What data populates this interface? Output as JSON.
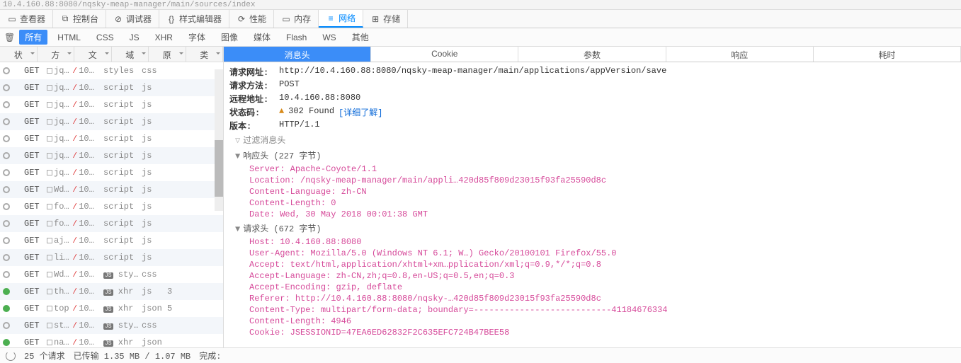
{
  "url_bar": "10.4.160.88:8080/nqsky-meap-manager/main/sources/index",
  "top_tabs": {
    "inspector": "查看器",
    "console": "控制台",
    "debugger": "调试器",
    "style": "样式编辑器",
    "perf": "性能",
    "memory": "内存",
    "network": "网络",
    "storage": "存储"
  },
  "filters": {
    "all": "所有",
    "html": "HTML",
    "css": "CSS",
    "js": "JS",
    "xhr": "XHR",
    "fonts": "字体",
    "images": "图像",
    "media": "媒体",
    "flash": "Flash",
    "ws": "WS",
    "other": "其他"
  },
  "columns": {
    "status": "状",
    "method": "方",
    "file": "文",
    "domain": "域",
    "cause": "原",
    "type": "类"
  },
  "rows": [
    {
      "dot": "grey",
      "method": "GET",
      "file": "jq…",
      "domain": "10…",
      "cause": "styles",
      "type": "css"
    },
    {
      "dot": "grey",
      "method": "GET",
      "file": "jq…",
      "domain": "10…",
      "cause": "script",
      "type": "js"
    },
    {
      "dot": "grey",
      "method": "GET",
      "file": "jq…",
      "domain": "10…",
      "cause": "script",
      "type": "js"
    },
    {
      "dot": "grey",
      "method": "GET",
      "file": "jq…",
      "domain": "10…",
      "cause": "script",
      "type": "js"
    },
    {
      "dot": "grey",
      "method": "GET",
      "file": "jq…",
      "domain": "10…",
      "cause": "script",
      "type": "js"
    },
    {
      "dot": "grey",
      "method": "GET",
      "file": "jq…",
      "domain": "10…",
      "cause": "script",
      "type": "js"
    },
    {
      "dot": "grey",
      "method": "GET",
      "file": "jq…",
      "domain": "10…",
      "cause": "script",
      "type": "js"
    },
    {
      "dot": "grey",
      "method": "GET",
      "file": "Wd…",
      "domain": "10…",
      "cause": "script",
      "type": "js"
    },
    {
      "dot": "grey",
      "method": "GET",
      "file": "fo…",
      "domain": "10…",
      "cause": "script",
      "type": "js"
    },
    {
      "dot": "grey",
      "method": "GET",
      "file": "fo…",
      "domain": "10…",
      "cause": "script",
      "type": "js"
    },
    {
      "dot": "grey",
      "method": "GET",
      "file": "aj…",
      "domain": "10…",
      "cause": "script",
      "type": "js"
    },
    {
      "dot": "grey",
      "method": "GET",
      "file": "li…",
      "domain": "10…",
      "cause": "script",
      "type": "js"
    },
    {
      "dot": "grey",
      "method": "GET",
      "file": "Wd…",
      "domain": "10…",
      "cause": "sty…",
      "type": "css",
      "js": true
    },
    {
      "dot": "green",
      "method": "GET",
      "file": "th…",
      "domain": "10…",
      "cause": "xhr",
      "type": "js",
      "js": true,
      "extra": "3"
    },
    {
      "dot": "green",
      "method": "GET",
      "file": "top",
      "domain": "10…",
      "cause": "xhr",
      "type": "json",
      "js": true,
      "extra": "5"
    },
    {
      "dot": "grey",
      "method": "GET",
      "file": "st…",
      "domain": "10…",
      "cause": "sty…",
      "type": "css",
      "js": true
    },
    {
      "dot": "green",
      "method": "GET",
      "file": "na…",
      "domain": "10…",
      "cause": "xhr",
      "type": "json",
      "js": true
    }
  ],
  "detail_tabs": {
    "headers": "消息头",
    "cookie": "Cookie",
    "params": "参数",
    "response": "响应",
    "timing": "耗时"
  },
  "summary": {
    "url_label": "请求网址:",
    "url": "http://10.4.160.88:8080/nqsky-meap-manager/main/applications/appVersion/save",
    "method_label": "请求方法:",
    "method": "POST",
    "remote_label": "远程地址:",
    "remote": "10.4.160.88:8080",
    "status_label": "状态码:",
    "status_code": "302 Found",
    "status_link": "[详细了解]",
    "version_label": "版本:",
    "version": "HTTP/1.1"
  },
  "filter_headers": "过滤消息头",
  "resp_head": "响应头 (227 字节)",
  "resp_headers": [
    {
      "k": "Server",
      "v": "Apache-Coyote/1.1"
    },
    {
      "k": "Location",
      "v": "/nqsky-meap-manager/main/appli…420d85f809d23015f93fa25590d8c"
    },
    {
      "k": "Content-Language",
      "v": "zh-CN"
    },
    {
      "k": "Content-Length",
      "v": "0"
    },
    {
      "k": "Date",
      "v": "Wed, 30 May 2018 00:01:38 GMT"
    }
  ],
  "req_head": "请求头 (672 字节)",
  "req_headers": [
    {
      "k": "Host",
      "v": "10.4.160.88:8080"
    },
    {
      "k": "User-Agent",
      "v": "Mozilla/5.0 (Windows NT 6.1; W…) Gecko/20100101 Firefox/55.0"
    },
    {
      "k": "Accept",
      "v": "text/html,application/xhtml+xm…pplication/xml;q=0.9,*/*;q=0.8"
    },
    {
      "k": "Accept-Language",
      "v": "zh-CN,zh;q=0.8,en-US;q=0.5,en;q=0.3"
    },
    {
      "k": "Accept-Encoding",
      "v": "gzip, deflate"
    },
    {
      "k": "Referer",
      "v": "http://10.4.160.88:8080/nqsky-…420d85f809d23015f93fa25590d8c"
    },
    {
      "k": "Content-Type",
      "v": "multipart/form-data; boundary=---------------------------41184676334"
    },
    {
      "k": "Content-Length",
      "v": "4946"
    },
    {
      "k": "Cookie",
      "v": "JSESSIONID=47EA6ED62832F2C635EFC724B47BEE58"
    }
  ],
  "status_bar": {
    "reqs": "25 个请求",
    "transfer": "已传输 1.35 MB / 1.07 MB",
    "done": "完成:"
  }
}
